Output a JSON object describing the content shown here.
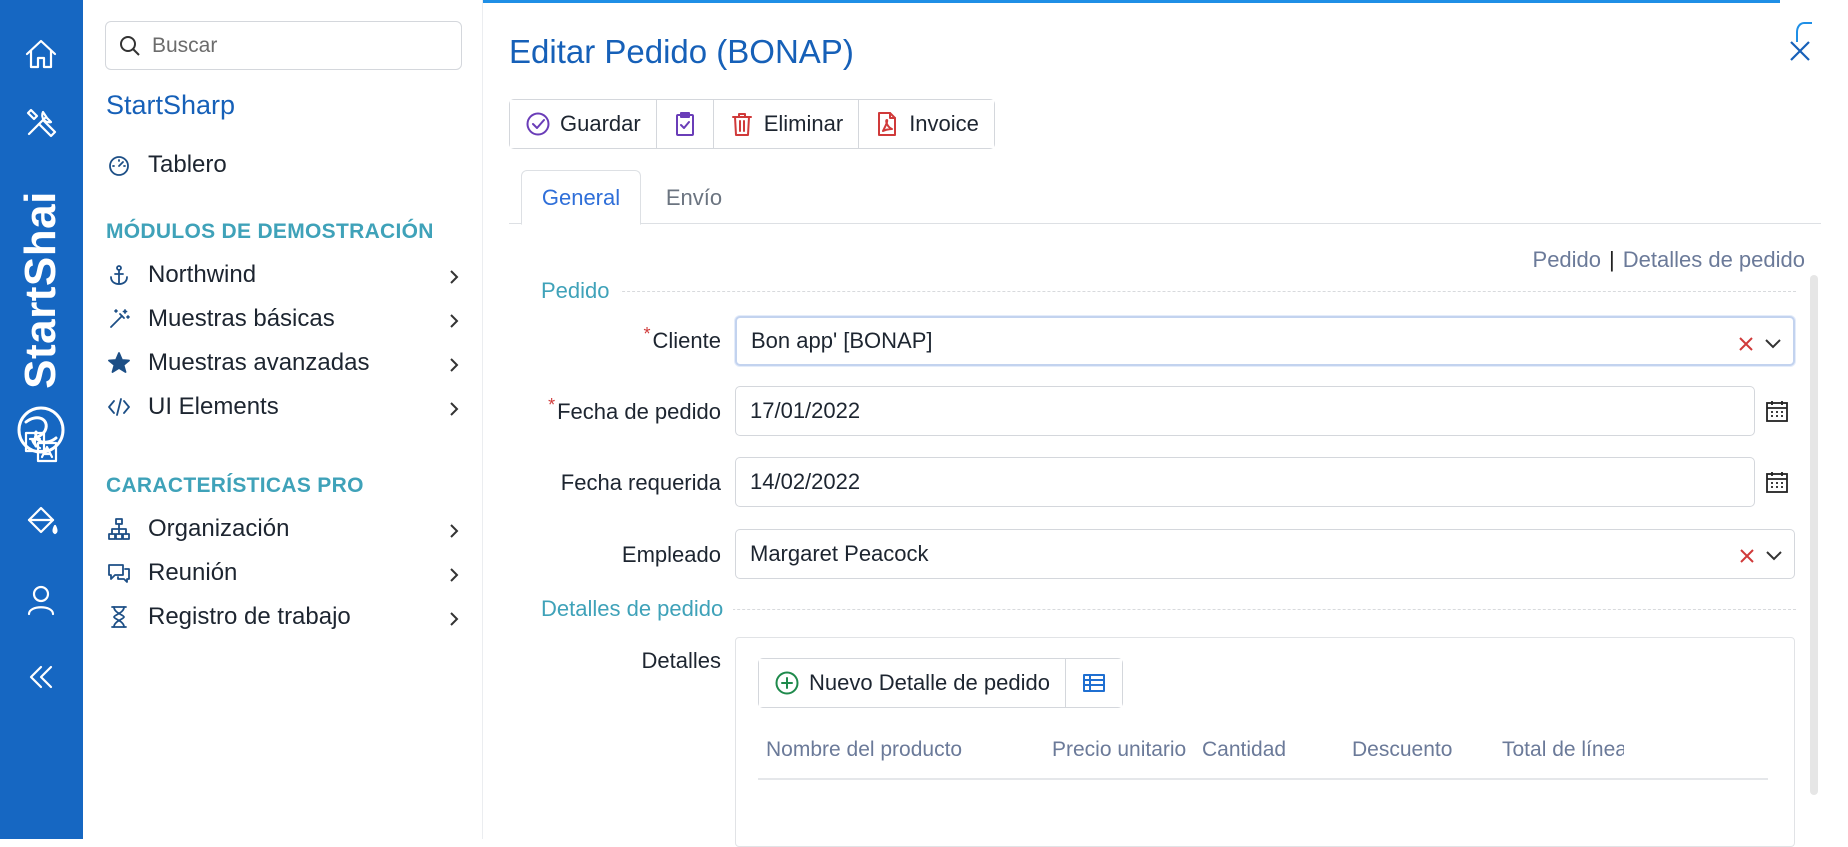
{
  "rail": {
    "brand": "StartShai",
    "icons": [
      "home-icon",
      "tools-icon",
      "translate-icon",
      "paint-bucket-icon",
      "user-icon",
      "collapse-icon"
    ]
  },
  "sidebar": {
    "search_placeholder": "Buscar",
    "app_title": "StartSharp",
    "dashboard": "Tablero",
    "section_demo": "MÓDULOS DE DEMOSTRACIÓN",
    "demo_items": [
      {
        "label": "Northwind",
        "icon": "anchor-icon"
      },
      {
        "label": "Muestras básicas",
        "icon": "magic-wand-icon"
      },
      {
        "label": "Muestras avanzadas",
        "icon": "star-icon"
      },
      {
        "label": "UI Elements",
        "icon": "code-icon"
      }
    ],
    "section_pro": "CARACTERÍSTICAS PRO",
    "pro_items": [
      {
        "label": "Organización",
        "icon": "org-chart-icon"
      },
      {
        "label": "Reunión",
        "icon": "chat-icon"
      },
      {
        "label": "Registro de trabajo",
        "icon": "hourglass-icon"
      }
    ]
  },
  "dialog": {
    "title": "Editar Pedido (BONAP)",
    "toolbar": {
      "save": "Guardar",
      "delete": "Eliminar",
      "invoice": "Invoice"
    },
    "tabs": [
      "General",
      "Envío"
    ],
    "active_tab": "General",
    "section_links": {
      "first": "Pedido",
      "separator": "|",
      "second": "Detalles de pedido"
    },
    "fieldsets": {
      "order": "Pedido",
      "details": "Detalles de pedido"
    },
    "fields": {
      "customer": {
        "label": "Cliente",
        "value": "Bon app' [BONAP]",
        "required": true
      },
      "order_date": {
        "label": "Fecha de pedido",
        "value": "17/01/2022",
        "required": true
      },
      "required_date": {
        "label": "Fecha requerida",
        "value": "14/02/2022",
        "required": false
      },
      "employee": {
        "label": "Empleado",
        "value": "Margaret Peacock",
        "required": false
      }
    },
    "details": {
      "label": "Detalles",
      "new_button": "Nuevo Detalle de pedido",
      "columns": [
        "Nombre del producto",
        "Precio unitario",
        "Cantidad",
        "Descuento",
        "Total de línea"
      ]
    }
  },
  "colors": {
    "rail": "#1667c2",
    "title": "#1660b8",
    "section": "#3fa2b9",
    "required": "#d03a3a"
  }
}
